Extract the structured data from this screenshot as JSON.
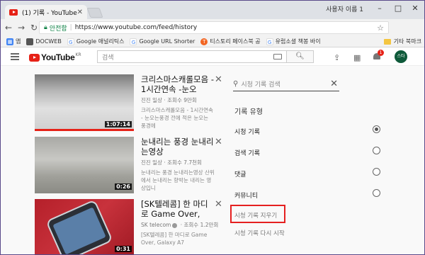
{
  "browser": {
    "tab_title": "(1) 기록 - YouTube",
    "tab_close": "✕",
    "user_name": "사용자 이름 1",
    "secure_label": "안전함",
    "url": "https://www.youtube.com/feed/history",
    "bookmarks": [
      {
        "label": "앱",
        "color": "#4285f4"
      },
      {
        "label": "DOCWEB",
        "color": "#555555"
      },
      {
        "label": "Google 애널리틱스",
        "color": "#4285f4"
      },
      {
        "label": "Google URL Shorter",
        "color": "#4285f4"
      },
      {
        "label": "티스토리 페이스북 공",
        "color": "#f26522"
      },
      {
        "label": "유럽소셜 책봉 바이",
        "color": "#4285f4"
      }
    ],
    "other_bookmarks": "기타 북마크"
  },
  "youtube": {
    "logo_text": "YouTube",
    "logo_region": "KR",
    "search_placeholder": "검색",
    "notification_count": "1",
    "avatar_text": "스타"
  },
  "videos": [
    {
      "title": "크리스마스캐롤모음 - 1시간연속 -눈오",
      "channel": "진진 일상",
      "views": "조회수 9만회",
      "description": "크리스마스캐롤모음 - 1시간연속 - 눈오는풍경 전에 적은 눈오는 풍경에",
      "duration": "1:07:14",
      "verified": false
    },
    {
      "title": "눈내리는 풍경 눈내리는영상",
      "channel": "진진 일상",
      "views": "조회수 7.7천회",
      "description": "눈내리는 풍경 눈내리는영상 산위에서 눈내리는 향박눈 내리는 영상입니",
      "duration": "0:26",
      "verified": false
    },
    {
      "title": "[SK텔레콤] 한 마디로 Game Over,",
      "channel": "SK telecom",
      "views": "조회수 1.2만회",
      "description": "[SK텔레콤] 한 마디로 Game Over, Galaxy A7",
      "duration": "0:31",
      "verified": true
    }
  ],
  "sidebar": {
    "search_placeholder": "시청 기록 검색",
    "section_title": "기록 유형",
    "options": [
      {
        "label": "시청 기록",
        "selected": true
      },
      {
        "label": "검색 기록",
        "selected": false
      },
      {
        "label": "댓글",
        "selected": false
      },
      {
        "label": "커뮤니티",
        "selected": false
      }
    ],
    "clear_history": "시청 기록 지우기",
    "resume_history": "시청 기록 다시 시작"
  }
}
